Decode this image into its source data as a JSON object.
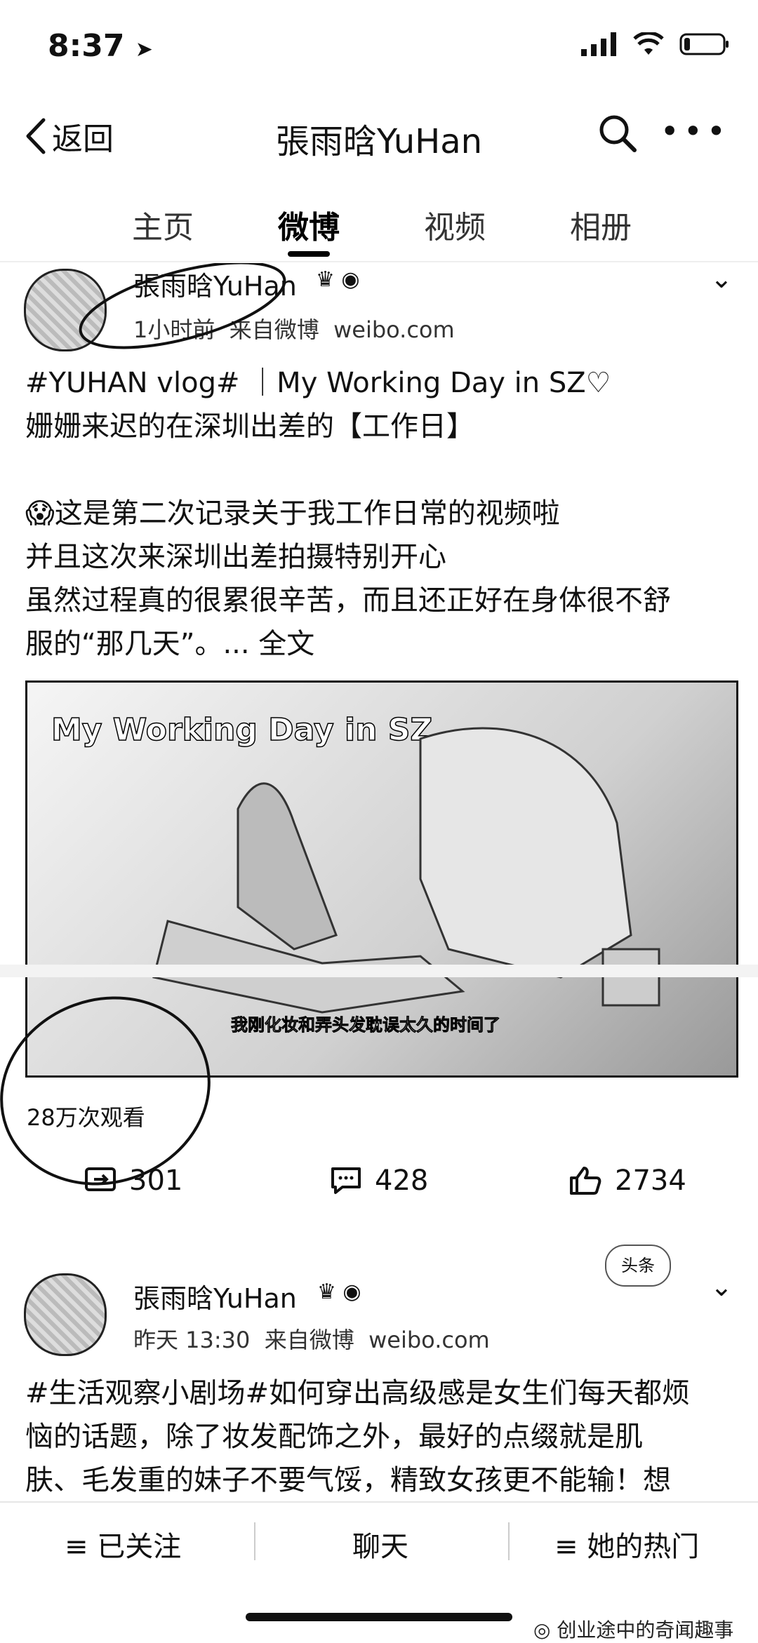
{
  "status_bar": {
    "time": "8:37"
  },
  "nav": {
    "back_label": "返回",
    "title": "張雨晗YuHan"
  },
  "tabs": [
    {
      "label": "主页"
    },
    {
      "label": "微博"
    },
    {
      "label": "视频"
    },
    {
      "label": "相册"
    }
  ],
  "active_tab": "微博",
  "post1": {
    "author": "張雨晗YuHan",
    "time": "1小时前",
    "source": "来自微博",
    "domain": "weibo.com",
    "lines": [
      "#YUHAN vlog# ｜My Working Day in SZ♡",
      "姗姗来迟的在深圳出差的【工作日】",
      "",
      "这是第二次记录关于我工作日常的视频啦",
      "并且这次来深圳出差拍摄特别开心",
      "虽然过程真的很累很辛苦，而且还正好在身体很不舒",
      "服的“那几天”。... 全文"
    ],
    "video_title": "My Working Day in SZ",
    "video_subtitle": "我刚化妆和弄头发耽误太久的时间了",
    "views": "28万次观看",
    "reposts": "301",
    "comments": "428",
    "likes": "2734"
  },
  "post2": {
    "author": "張雨晗YuHan",
    "time": "昨天 13:30",
    "source": "来自微博",
    "domain": "weibo.com",
    "badge": "头条",
    "lines": [
      "#生活观察小剧场#如何穿出高级感是女生们每天都烦",
      "恼的话题，除了妆发配饰之外，最好的点缀就是肌",
      "肤、毛发重的妹子不要气馁，精致女孩更不能输！想"
    ]
  },
  "bottom_bar": {
    "follow": "≡ 已关注",
    "chat": "聊天",
    "hot": "≡ 她的热门"
  },
  "watermark": "创业途中的奇闻趣事"
}
